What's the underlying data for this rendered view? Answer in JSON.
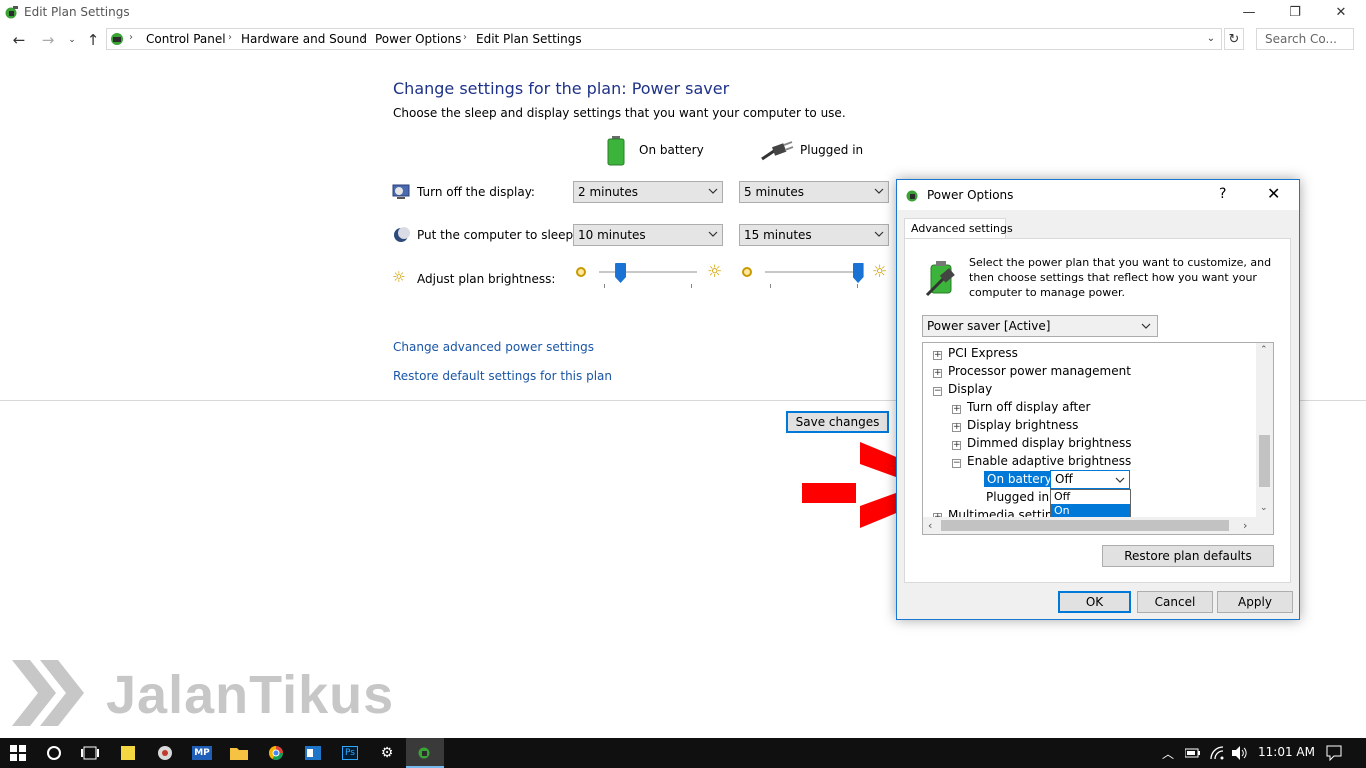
{
  "window": {
    "title": "Edit Plan Settings",
    "minimize_glyph": "—",
    "maximize_glyph": "❐",
    "close_glyph": "✕"
  },
  "address": {
    "crumbs": [
      "Control Panel",
      "Hardware and Sound",
      "Power Options",
      "Edit Plan Settings"
    ],
    "search_placeholder": "Search Co..."
  },
  "main": {
    "heading": "Change settings for the plan: Power saver",
    "subheading": "Choose the sleep and display settings that you want your computer to use.",
    "col_battery": "On battery",
    "col_plugged": "Plugged in",
    "rows": {
      "display_label": "Turn off the display:",
      "display_battery": "2 minutes",
      "display_plugged": "5 minutes",
      "sleep_label": "Put the computer to sleep:",
      "sleep_battery": "10 minutes",
      "sleep_plugged": "15 minutes",
      "brightness_label": "Adjust plan brightness:",
      "brightness_battery": 0.22,
      "brightness_plugged": 0.95
    },
    "link_advanced": "Change advanced power settings",
    "link_restore": "Restore default settings for this plan",
    "save_button": "Save changes"
  },
  "dialog": {
    "title": "Power Options",
    "help": "?",
    "close": "✕",
    "tab": "Advanced settings",
    "description": "Select the power plan that you want to customize, and then choose settings that reflect how you want your computer to manage power.",
    "plan_selected": "Power saver [Active]",
    "tree": {
      "pci": "PCI Express",
      "processor": "Processor power management",
      "display": "Display",
      "turn_off": "Turn off display after",
      "brightness": "Display brightness",
      "dimmed": "Dimmed display brightness",
      "adaptive": "Enable adaptive brightness",
      "on_battery": "On battery:",
      "on_battery_value": "Off",
      "plugged_in": "Plugged in:",
      "multimedia": "Multimedia settings",
      "expand_glyph": "+",
      "collapse_glyph": "−"
    },
    "dropdown_options": [
      "Off",
      "On"
    ],
    "restore_button": "Restore plan defaults",
    "ok": "OK",
    "cancel": "Cancel",
    "apply": "Apply"
  },
  "watermark": "JalanTikus",
  "taskbar": {
    "time": "11:01 AM",
    "mp_label": "MP",
    "ps_label": "Ps"
  }
}
